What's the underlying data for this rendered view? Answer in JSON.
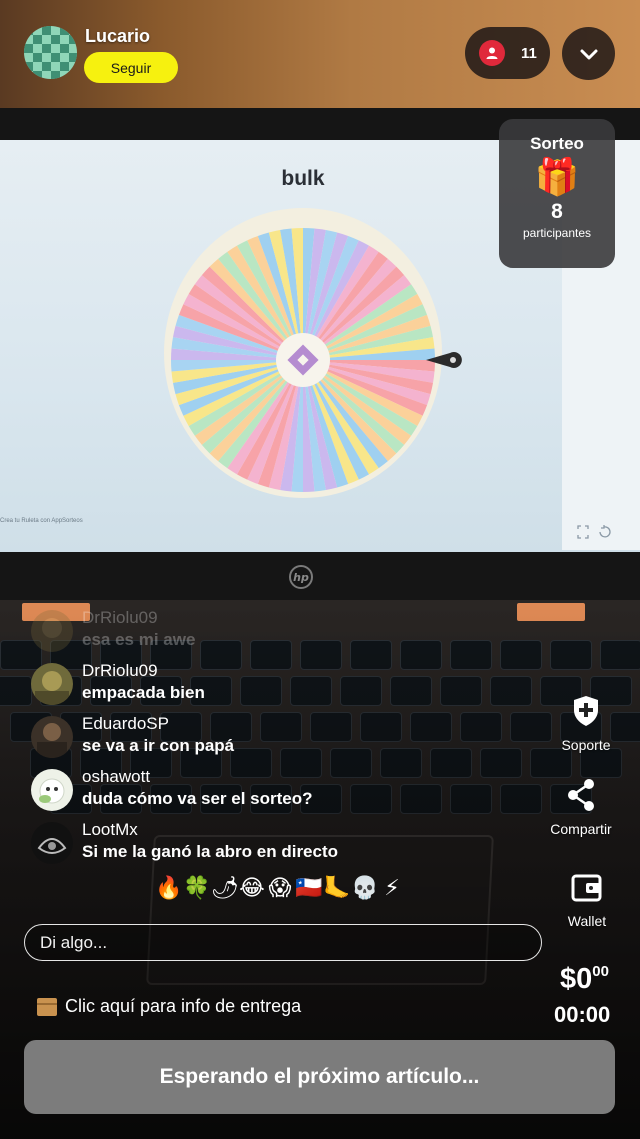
{
  "streamer": {
    "name": "Lucario",
    "follow_label": "Seguir"
  },
  "viewers": {
    "count": "11"
  },
  "raffle": {
    "title": "Sorteo",
    "count": "8",
    "label": "participantes"
  },
  "stream_screen": {
    "wheel_title": "bulk",
    "footer_text": "Crea tu Ruleta con  AppSorteos"
  },
  "chat": [
    {
      "user": "DrRiolu09",
      "text": "esa es mi awe",
      "faded": true
    },
    {
      "user": "DrRiolu09",
      "text": "empacada bien"
    },
    {
      "user": "EduardoSP",
      "text": "se va a ir con papá"
    },
    {
      "user": "oshawott",
      "text": "duda cómo va ser el sorteo?"
    },
    {
      "user": "LootMx",
      "text": "Si me la ganó la abro en directo"
    }
  ],
  "actions": {
    "support": "Soporte",
    "share": "Compartir",
    "wallet": "Wallet"
  },
  "emojis": [
    "🔥",
    "🍀",
    "🌶",
    "😂",
    "😱",
    "🇨🇱",
    "🦶",
    "💀",
    "⚡"
  ],
  "input": {
    "placeholder": "Di algo..."
  },
  "delivery_info": "Clic aquí para info de entrega",
  "price": {
    "main": "$0",
    "cents": "00"
  },
  "timer": "00:00",
  "wait_button": "Esperando el próximo artículo...",
  "colors": {
    "follow": "#f6f10f",
    "viewer_dot": "#e0293b",
    "wait_button": "#7c7c7c"
  },
  "icons": [
    "person-icon",
    "chevron-down-icon",
    "gift-icon",
    "shield-plus-icon",
    "share-icon",
    "wallet-icon",
    "package-icon"
  ]
}
